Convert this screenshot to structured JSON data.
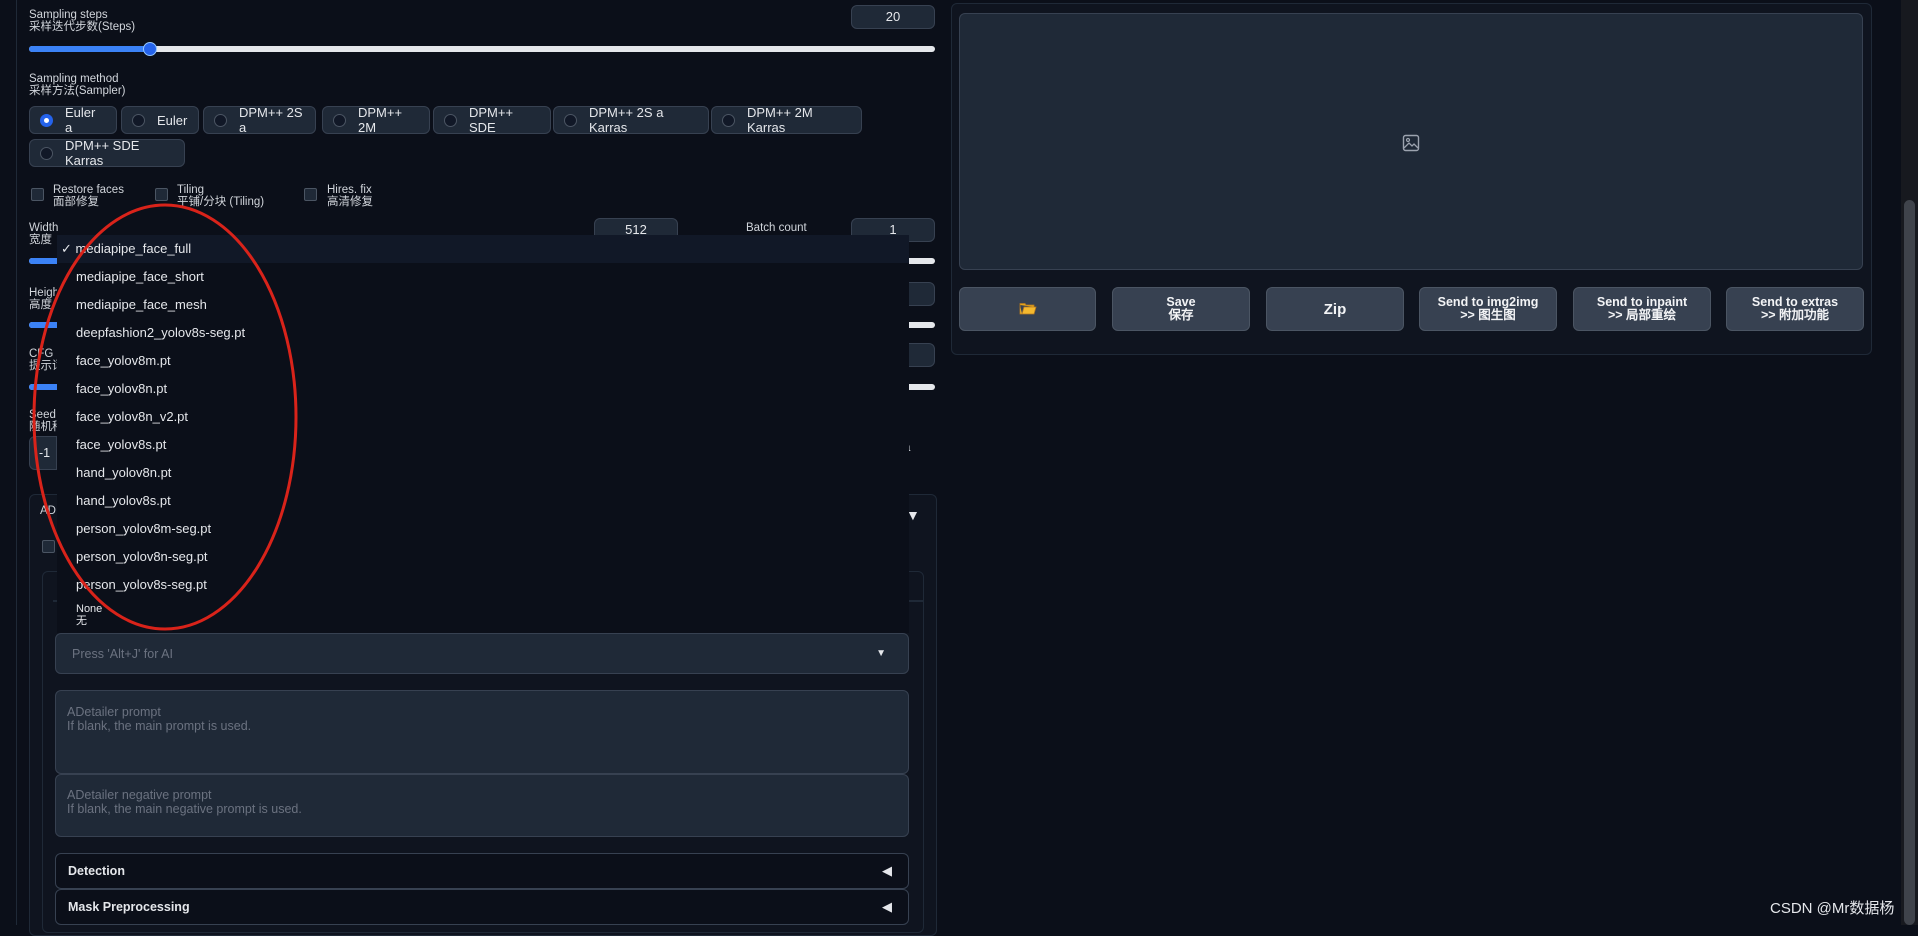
{
  "sampling_steps": {
    "label_en": "Sampling steps",
    "label_zh": "采样迭代步数(Steps)",
    "value": "20",
    "fraction": 0.13
  },
  "sampler": {
    "label_en": "Sampling method",
    "label_zh": "采样方法(Sampler)",
    "options": [
      "Euler a",
      "Euler",
      "DPM++ 2S a",
      "DPM++ 2M",
      "DPM++ SDE",
      "DPM++ 2S a Karras",
      "DPM++ 2M Karras",
      "DPM++ SDE Karras"
    ],
    "selected": "Euler a"
  },
  "checkboxes": {
    "restore_faces_en": "Restore faces",
    "restore_faces_zh": "面部修复",
    "tiling_en": "Tiling",
    "tiling_zh": "平铺/分块 (Tiling)",
    "hires_en": "Hires. fix",
    "hires_zh": "高清修复"
  },
  "width": {
    "label_en": "Width",
    "label_zh": "宽度",
    "value": "512"
  },
  "batch_count": {
    "label_en": "Batch count",
    "value": "1"
  },
  "height_label_fragment": "Heigh",
  "height_zh_fragment": "高度",
  "cfg_label_fragment": "CFG S",
  "cfg_zh_fragment": "提示词",
  "seed_label_fragment": "Seed",
  "seed_zh_fragment": "随机种",
  "seed_value_fragment": "-1",
  "right_fragment": "a",
  "adetailer_fragment": "AD",
  "dropdown_menu": {
    "checkmark": "✓",
    "items": [
      "mediapipe_face_full",
      "mediapipe_face_short",
      "mediapipe_face_mesh",
      "deepfashion2_yolov8s-seg.pt",
      "face_yolov8m.pt",
      "face_yolov8n.pt",
      "face_yolov8n_v2.pt",
      "face_yolov8s.pt",
      "hand_yolov8n.pt",
      "hand_yolov8s.pt",
      "person_yolov8m-seg.pt",
      "person_yolov8n-seg.pt",
      "person_yolov8s-seg.pt"
    ],
    "none_en": "None",
    "none_zh": "无"
  },
  "ai_select": {
    "placeholder": "Press 'Alt+J' for AI"
  },
  "adetailer_prompt": {
    "line1": "ADetailer prompt",
    "line2": "If blank, the main prompt is used."
  },
  "adetailer_negative": {
    "line1": "ADetailer negative prompt",
    "line2": "If blank, the main negative prompt is used."
  },
  "accordions": {
    "detection": "Detection",
    "mask": "Mask Preprocessing"
  },
  "output_buttons": {
    "save_en": "Save",
    "save_zh": "保存",
    "zip": "Zip",
    "img2img_en": "Send to img2img",
    "img2img_zh": ">> 图生图",
    "inpaint_en": "Send to inpaint",
    "inpaint_zh": ">> 局部重绘",
    "extras_en": "Send to extras",
    "extras_zh": ">> 附加功能"
  },
  "watermark": "CSDN @Mr数据杨",
  "colors": {
    "accent": "#2563eb",
    "annotation_circle": "#d9231a",
    "folder_icon": "#f5b92e"
  }
}
